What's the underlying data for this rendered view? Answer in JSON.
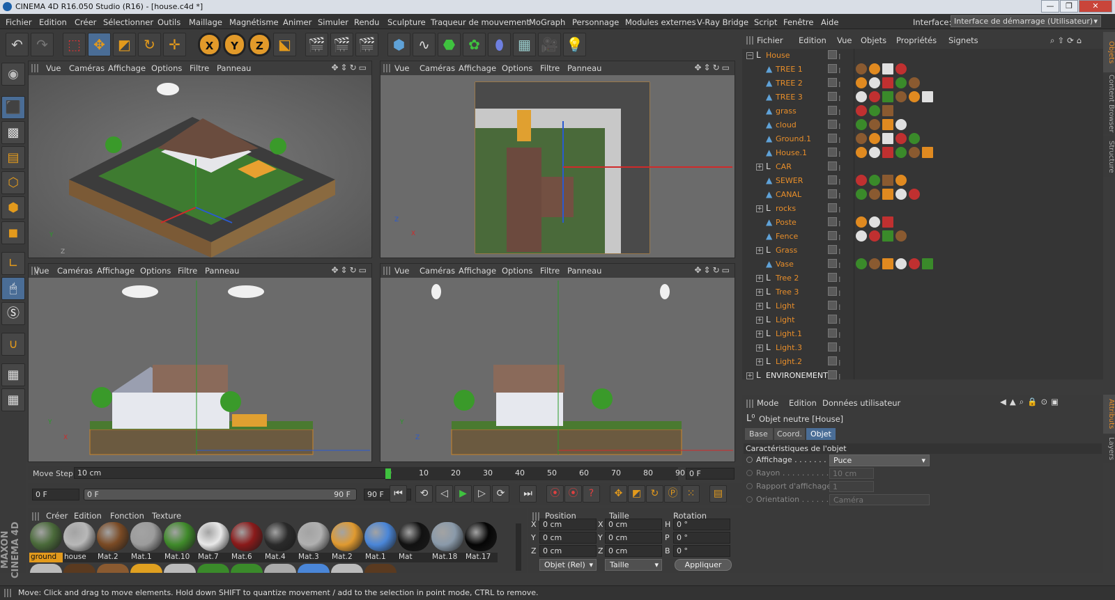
{
  "window": {
    "title": "CINEMA 4D R16.050 Studio (R16) - [house.c4d *]"
  },
  "menubar": {
    "items": [
      "Fichier",
      "Edition",
      "Créer",
      "Sélectionner",
      "Outils",
      "Maillage",
      "Magnétisme",
      "Animer",
      "Simuler",
      "Rendu",
      "Sculpture",
      "Traqueur de mouvement",
      "MoGraph",
      "Personnage",
      "Modules externes",
      "V-Ray Bridge",
      "Script",
      "Fenêtre",
      "Aide"
    ],
    "interface_label": "Interface:",
    "interface_value": "Interface de démarrage (Utilisateur)"
  },
  "toolbar": {
    "axis_x": "X",
    "axis_y": "Y",
    "axis_z": "Z"
  },
  "viewport": {
    "menu": [
      "Vue",
      "Caméras",
      "Affichage",
      "Options",
      "Filtre",
      "Panneau"
    ]
  },
  "objects": {
    "menu": [
      "Fichier",
      "Edition",
      "Vue",
      "Objets",
      "Propriétés",
      "Signets"
    ],
    "rows": [
      {
        "name": "House",
        "expanded": true,
        "level": 0,
        "type": "null"
      },
      {
        "name": "TREE 1",
        "level": 1,
        "type": "poly"
      },
      {
        "name": "TREE 2",
        "level": 1,
        "type": "poly"
      },
      {
        "name": "TREE 3",
        "level": 1,
        "type": "poly"
      },
      {
        "name": "grass",
        "level": 1,
        "type": "poly"
      },
      {
        "name": "cloud",
        "level": 1,
        "type": "poly"
      },
      {
        "name": "Ground.1",
        "level": 1,
        "type": "poly"
      },
      {
        "name": "House.1",
        "level": 1,
        "type": "poly"
      },
      {
        "name": "CAR",
        "level": 1,
        "type": "null"
      },
      {
        "name": "SEWER",
        "level": 1,
        "type": "poly"
      },
      {
        "name": "CANAL",
        "level": 1,
        "type": "poly"
      },
      {
        "name": "rocks",
        "level": 1,
        "type": "null"
      },
      {
        "name": "Poste",
        "level": 1,
        "type": "poly"
      },
      {
        "name": "Fence",
        "level": 1,
        "type": "poly"
      },
      {
        "name": "Grass",
        "level": 1,
        "type": "null"
      },
      {
        "name": "Vase",
        "level": 1,
        "type": "poly"
      },
      {
        "name": "Tree 2",
        "level": 1,
        "type": "null"
      },
      {
        "name": "Tree 3",
        "level": 1,
        "type": "null"
      },
      {
        "name": "Light",
        "level": 1,
        "type": "null"
      },
      {
        "name": "Light",
        "level": 1,
        "type": "null"
      },
      {
        "name": "Light.1",
        "level": 1,
        "type": "null"
      },
      {
        "name": "Light.3",
        "level": 1,
        "type": "null"
      },
      {
        "name": "Light.2",
        "level": 1,
        "type": "null"
      },
      {
        "name": "ENVIRONEMENT",
        "level": 0,
        "type": "null"
      }
    ]
  },
  "sidetabs": {
    "objects": "Objets",
    "content": "Content Browser",
    "structure": "Structure",
    "attributs": "Attributs",
    "layers": "Layers"
  },
  "attributes": {
    "menu": [
      "Mode",
      "Edition",
      "Données utilisateur"
    ],
    "object_title": "Objet neutre [House]",
    "tabs": [
      "Base",
      "Coord.",
      "Objet"
    ],
    "active_tab": "Objet",
    "section": "Caractéristiques de l'objet",
    "fields": [
      {
        "label": "Affichage . . . . . . . . .",
        "value": "Puce"
      },
      {
        "label": "Rayon . . . . . . . . . . .",
        "value": "10 cm"
      },
      {
        "label": "Rapport d'affichage",
        "value": "1"
      },
      {
        "label": "Orientation . . . . . . .",
        "value": "Caméra"
      }
    ]
  },
  "timeline": {
    "move_step_label": "Move Step",
    "move_step_value": "10 cm",
    "ticks": [
      "0",
      "10",
      "20",
      "30",
      "40",
      "50",
      "60",
      "70",
      "80",
      "90"
    ],
    "current_frame": "0 F",
    "start": "0 F",
    "slider_start": "0 F",
    "slider_end": "90 F",
    "end": "90 F"
  },
  "materials": {
    "menu": [
      "Créer",
      "Edition",
      "Fonction",
      "Texture"
    ],
    "row1": [
      {
        "name": "ground",
        "color": "#4a6a3a"
      },
      {
        "name": "house",
        "color": "#b8b8b8"
      },
      {
        "name": "Mat.2",
        "color": "#7a4a24"
      },
      {
        "name": "Mat.1",
        "color": "#9c9c9c"
      },
      {
        "name": "Mat.10",
        "color": "#3f8a2a"
      },
      {
        "name": "Mat.7",
        "color": "#e8e8e8"
      },
      {
        "name": "Mat.6",
        "color": "#8a1a1a"
      },
      {
        "name": "Mat.4",
        "color": "#2a2a2a"
      },
      {
        "name": "Mat.3",
        "color": "#b0b0b0"
      },
      {
        "name": "Mat.2",
        "color": "#e09a30"
      },
      {
        "name": "Mat.1",
        "color": "#4a86d8"
      },
      {
        "name": "Mat",
        "color": "#111111"
      },
      {
        "name": "Mat.18",
        "color": "#8a9aaa"
      },
      {
        "name": "Mat.17",
        "color": "#050505"
      }
    ]
  },
  "coordinates": {
    "headers": [
      "Position",
      "Taille",
      "Rotation"
    ],
    "rows": [
      {
        "a": "X",
        "pos": "0 cm",
        "b": "X",
        "size": "0 cm",
        "c": "H",
        "rot": "0 °"
      },
      {
        "a": "Y",
        "pos": "0 cm",
        "b": "Y",
        "size": "0 cm",
        "c": "P",
        "rot": "0 °"
      },
      {
        "a": "Z",
        "pos": "0 cm",
        "b": "Z",
        "size": "0 cm",
        "c": "B",
        "rot": "0 °"
      }
    ],
    "mode": "Objet (Rel)",
    "size_mode": "Taille",
    "apply": "Appliquer"
  },
  "status": {
    "text": "Move: Click and drag to move elements. Hold down SHIFT to quantize movement / add to the selection in point mode, CTRL to remove."
  },
  "branding": {
    "logo": "MAXON CINEMA 4D"
  }
}
